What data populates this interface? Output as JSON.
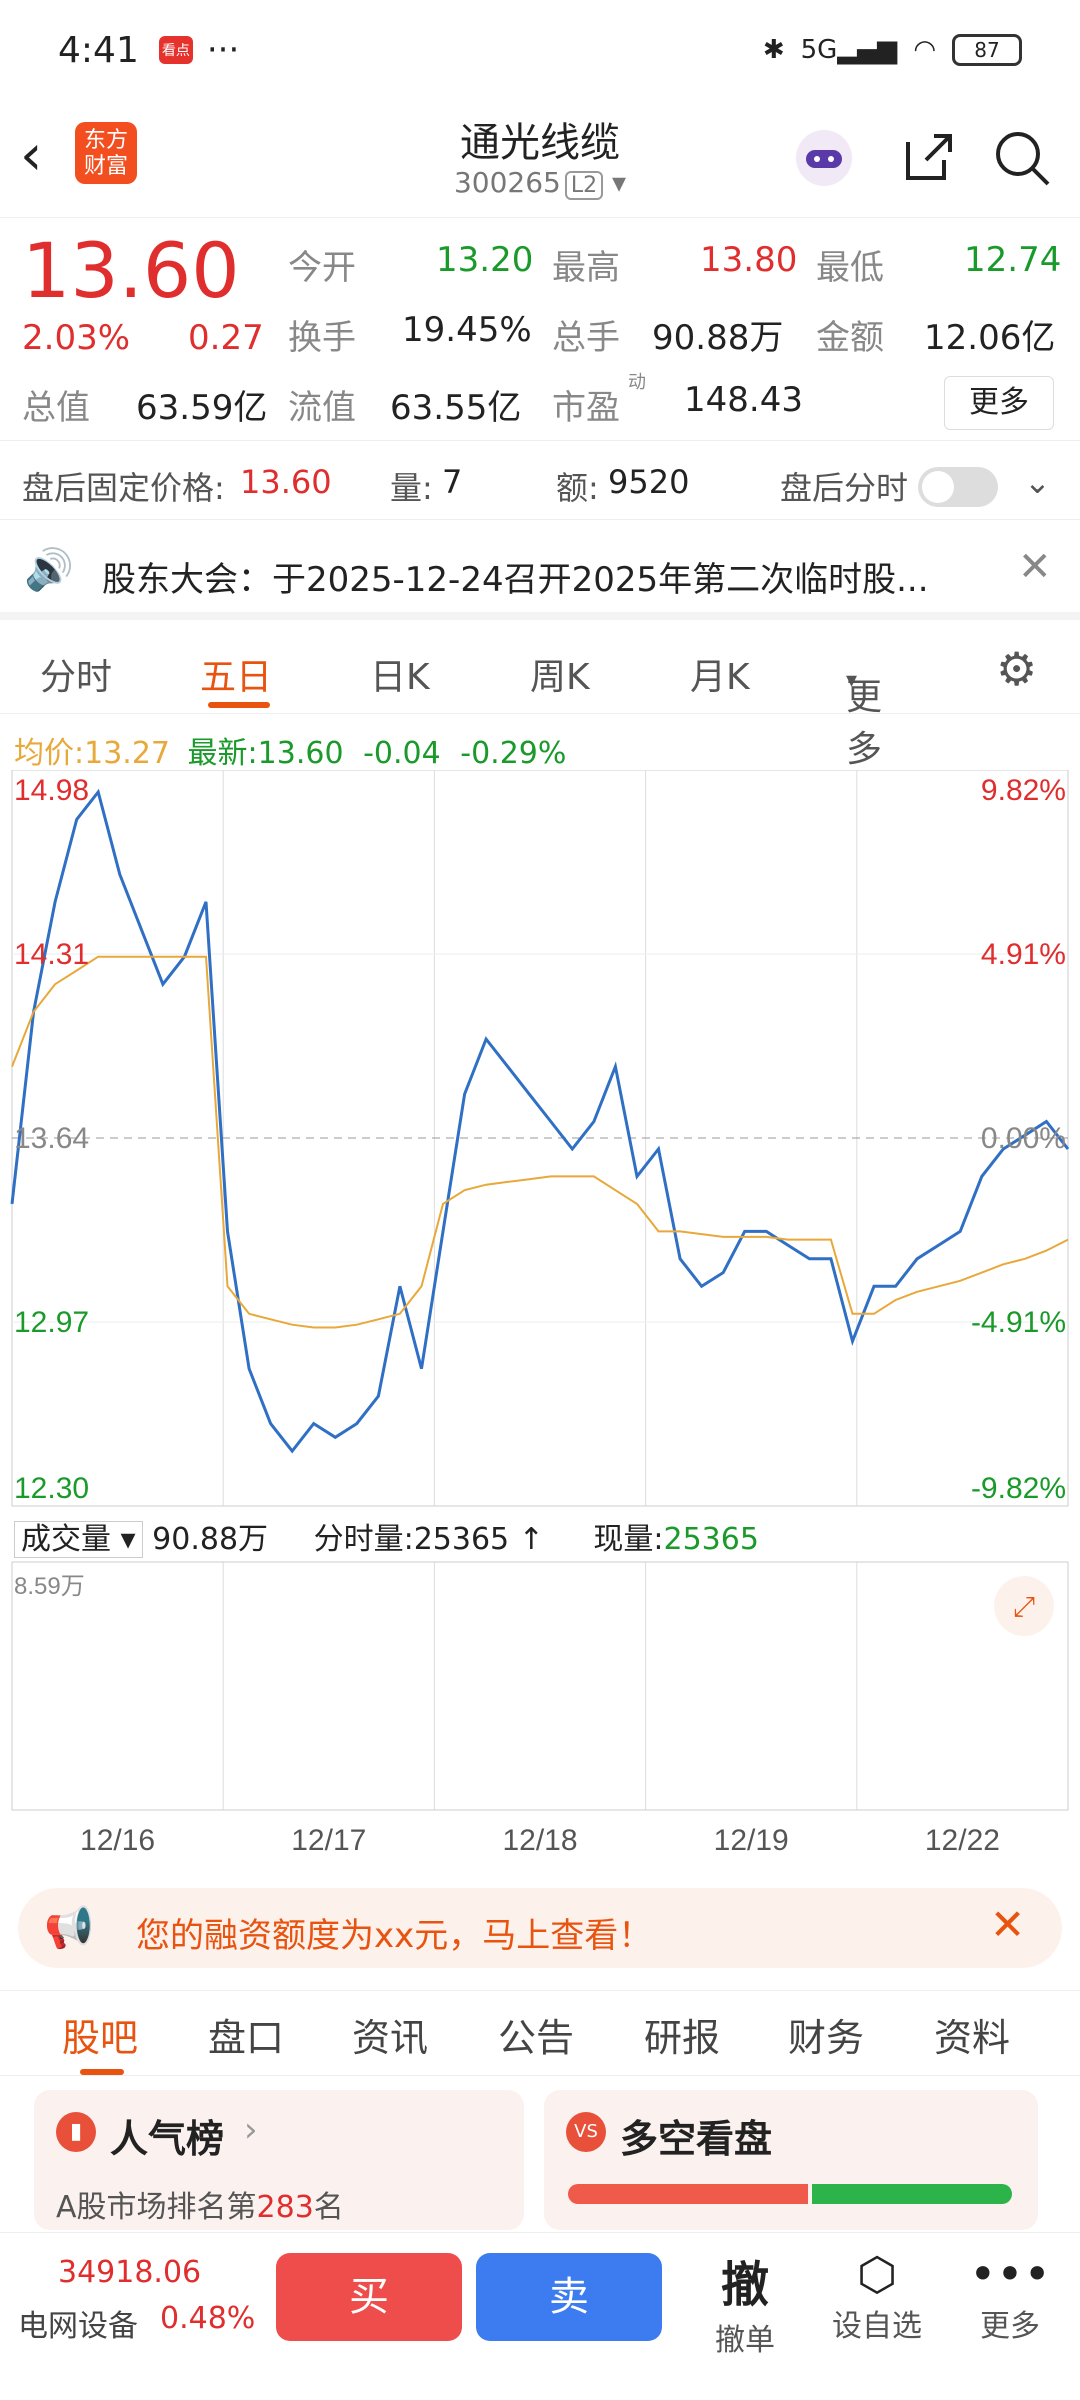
{
  "status": {
    "time": "4:41",
    "network": "5G",
    "battery": "87"
  },
  "header": {
    "title": "通光线缆",
    "code": "300265",
    "level": "L2",
    "logo_line1": "东方",
    "logo_line2": "财富"
  },
  "quote": {
    "price": "13.60",
    "change_pct": "2.03%",
    "change": "0.27",
    "open_label": "今开",
    "open": "13.20",
    "high_label": "最高",
    "high": "13.80",
    "low_label": "最低",
    "low": "12.74",
    "turnover_label": "换手",
    "turnover": "19.45%",
    "volume_label": "总手",
    "volume": "90.88万",
    "amount_label": "金额",
    "amount": "12.06亿",
    "mcap_label": "总值",
    "mcap": "63.59亿",
    "float_label": "流值",
    "float": "63.55亿",
    "pe_label": "市盈",
    "pe_sup": "动",
    "pe": "148.43",
    "more": "更多"
  },
  "afterhours": {
    "label": "盘后固定价格:",
    "price": "13.60",
    "vol_label": "量:",
    "vol": "7",
    "amt_label": "额:",
    "amt": "9520",
    "toggle_label": "盘后分时"
  },
  "notice": {
    "text": "股东大会：于2025-12-24召开2025年第二次临时股..."
  },
  "chart_tabs": [
    "分时",
    "五日",
    "日K",
    "周K",
    "月K",
    "更多"
  ],
  "legend": {
    "avg_label": "均价:",
    "avg": "13.27",
    "last_label": "最新:",
    "last": "13.60",
    "chg": "-0.04",
    "pct": "-0.29%"
  },
  "chart_data": {
    "type": "line",
    "y_left_ticks": [
      "14.98",
      "14.31",
      "13.64",
      "12.97",
      "12.30"
    ],
    "y_right_ticks": [
      "9.82%",
      "4.91%",
      "0.00%",
      "-4.91%",
      "-9.82%"
    ],
    "x_labels": [
      "12/16",
      "12/17",
      "12/18",
      "12/19",
      "12/22"
    ],
    "ylim": [
      12.3,
      14.98
    ],
    "series": [
      {
        "name": "最新",
        "color": "#2f6fc4",
        "values": [
          13.4,
          14.1,
          14.5,
          14.8,
          14.9,
          14.6,
          14.4,
          14.2,
          14.3,
          14.5,
          13.3,
          12.8,
          12.6,
          12.5,
          12.6,
          12.55,
          12.6,
          12.7,
          13.1,
          12.8,
          13.3,
          13.8,
          14.0,
          13.9,
          13.8,
          13.7,
          13.6,
          13.7,
          13.9,
          13.5,
          13.6,
          13.2,
          13.1,
          13.15,
          13.3,
          13.3,
          13.25,
          13.2,
          13.2,
          12.9,
          13.1,
          13.1,
          13.2,
          13.25,
          13.3,
          13.5,
          13.6,
          13.65,
          13.7,
          13.6
        ]
      },
      {
        "name": "均价",
        "color": "#e8a83a",
        "values": [
          13.9,
          14.1,
          14.2,
          14.25,
          14.3,
          14.3,
          14.3,
          14.3,
          14.3,
          14.3,
          13.1,
          13.0,
          12.98,
          12.96,
          12.95,
          12.95,
          12.96,
          12.98,
          13.0,
          13.1,
          13.4,
          13.45,
          13.47,
          13.48,
          13.49,
          13.5,
          13.5,
          13.5,
          13.45,
          13.4,
          13.3,
          13.3,
          13.29,
          13.28,
          13.28,
          13.28,
          13.27,
          13.27,
          13.27,
          13.0,
          13.0,
          13.05,
          13.08,
          13.1,
          13.12,
          13.15,
          13.18,
          13.2,
          13.23,
          13.27
        ]
      }
    ]
  },
  "volume": {
    "label": "成交量",
    "total": "90.88万",
    "fs_label": "分时量:",
    "fs": "25365",
    "now_label": "现量:",
    "now": "25365",
    "max_label": "8.59万"
  },
  "banner": {
    "text": "您的融资额度为xx元，马上查看！"
  },
  "bottom_tabs": [
    "股吧",
    "盘口",
    "资讯",
    "公告",
    "研报",
    "财务",
    "资料"
  ],
  "cards": {
    "left_title": "人气榜",
    "left_sub_prefix": "A股市场排名第",
    "left_rank": "283",
    "left_sub_suffix": "名",
    "right_title": "多空看盘"
  },
  "bottombar": {
    "index_value": "34918.06",
    "index_name": "电网设备",
    "index_pct": "0.48%",
    "buy": "买",
    "sell": "卖",
    "cancel": "撤单",
    "cancel_icon": "撤",
    "watch": "设自选",
    "more": "更多"
  }
}
